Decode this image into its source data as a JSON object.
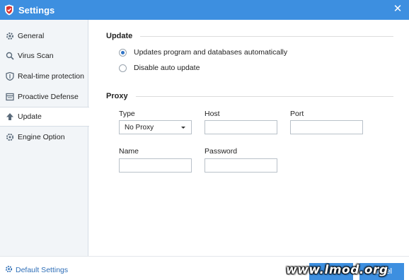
{
  "window": {
    "title": "Settings"
  },
  "sidebar": {
    "items": [
      {
        "label": "General",
        "icon": "gear-icon"
      },
      {
        "label": "Virus Scan",
        "icon": "search-icon"
      },
      {
        "label": "Real-time protection",
        "icon": "shield-icon"
      },
      {
        "label": "Proactive Defense",
        "icon": "panel-icon"
      },
      {
        "label": "Update",
        "icon": "arrow-up-icon",
        "active": true
      },
      {
        "label": "Engine Option",
        "icon": "engine-gear-icon"
      }
    ]
  },
  "update": {
    "section_title": "Update",
    "options": [
      {
        "label": "Updates program and databases automatically",
        "checked": true
      },
      {
        "label": "Disable auto update",
        "checked": false
      }
    ]
  },
  "proxy": {
    "section_title": "Proxy",
    "type_label": "Type",
    "type_value": "No Proxy",
    "host_label": "Host",
    "host_value": "",
    "port_label": "Port",
    "port_value": "",
    "name_label": "Name",
    "name_value": "",
    "password_label": "Password",
    "password_value": ""
  },
  "footer": {
    "default_settings_label": "Default Settings",
    "ok_label": "",
    "cancel_label": "ancel"
  },
  "watermark": "www.lmod.org",
  "colors": {
    "accent": "#3d8fe0",
    "link": "#2f6fb8",
    "sidebar_bg": "#f2f5f8"
  }
}
